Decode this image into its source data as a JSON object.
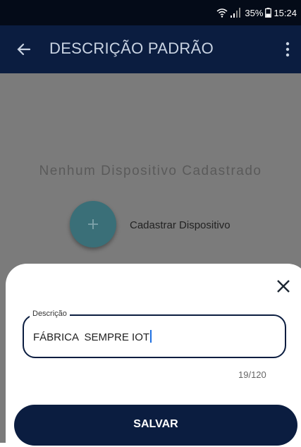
{
  "status_bar": {
    "battery": "35%",
    "time": "15:24",
    "icons": [
      "wifi-icon",
      "signal-icon",
      "battery-icon"
    ]
  },
  "app_bar": {
    "title": "DESCRIÇÃO PADRÃO",
    "icons": [
      "back-arrow-icon",
      "more-vert-icon"
    ]
  },
  "content": {
    "empty_message": "Nenhum Dispositivo Cadastrado",
    "add_label": "Cadastrar Dispositivo",
    "add_icon": "plus-icon"
  },
  "sheet": {
    "close_icon": "close-icon",
    "field_label": "Descrição",
    "field_value": "FÁBRICA  SEMPRE IOT",
    "counter": "19/120",
    "save_label": "SALVAR"
  },
  "colors": {
    "primary": "#0b1d40",
    "fab": "#3a6f78",
    "overlay": "#7b7b7b",
    "caret": "#1e6fe0"
  }
}
